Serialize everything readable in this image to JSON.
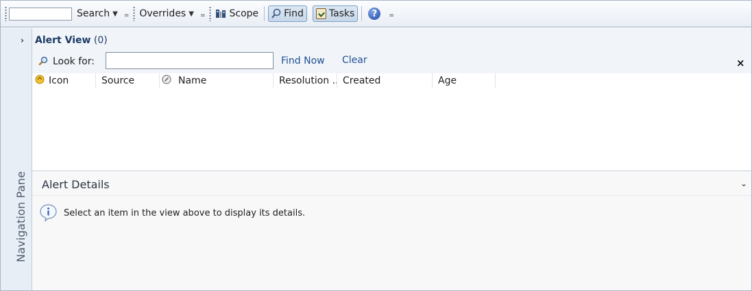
{
  "toolbar": {
    "search_label": "Search",
    "overrides_label": "Overrides",
    "scope_label": "Scope",
    "find_label": "Find",
    "tasks_label": "Tasks",
    "overflow_glyph": "=",
    "caret_glyph": "▼",
    "help_glyph": "?"
  },
  "navigation": {
    "label": "Navigation Pane",
    "expand_glyph": "›"
  },
  "alert_view": {
    "title": "Alert View",
    "count": "(0)",
    "look_for_label": "Look for:",
    "search_value": "",
    "find_now_label": "Find Now",
    "clear_label": "Clear",
    "close_glyph": "×",
    "columns": [
      {
        "label": "Icon"
      },
      {
        "label": "Source"
      },
      {
        "label": "Name"
      },
      {
        "label": "Resolution ..."
      },
      {
        "label": "Created"
      },
      {
        "label": "Age"
      }
    ]
  },
  "alert_details": {
    "title": "Alert Details",
    "toggle_glyph": "⌄",
    "message": "Select an item in the view above to display its details."
  },
  "colors": {
    "link": "#1d4f91",
    "header_bg": "#f1f5fa",
    "nav_bg": "#e8eef6"
  }
}
